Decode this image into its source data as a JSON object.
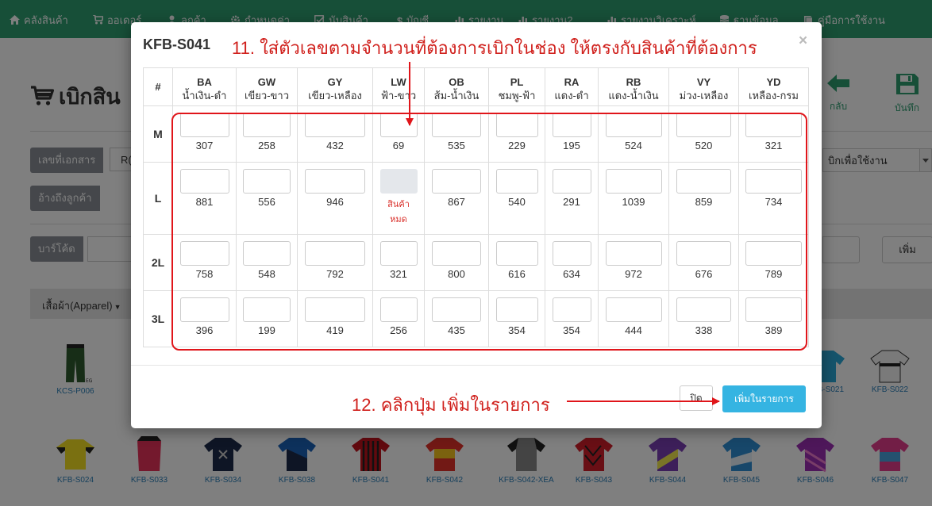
{
  "navbar": {
    "items": [
      {
        "label": "คลังสินค้า",
        "icon": "home-icon"
      },
      {
        "label": "ออเดอร์",
        "icon": "cart-icon"
      },
      {
        "label": "ลูกค้า",
        "icon": "user-icon"
      },
      {
        "label": "กำหนดค่า",
        "icon": "gear-icon"
      },
      {
        "label": "นับสินค้า",
        "icon": "checkbox-icon"
      },
      {
        "label": "บัญชี",
        "icon": "dollar-icon"
      },
      {
        "label": "รายงาน",
        "icon": "bar-chart-icon"
      },
      {
        "label": "รายงาน2",
        "icon": "bar-chart-icon"
      },
      {
        "label": "รายงานวิเคราะห์",
        "icon": "bar-chart-icon"
      },
      {
        "label": "ฐานข้อมูล",
        "icon": "database-icon"
      },
      {
        "label": "คู่มือการใช้งาน",
        "icon": "book-icon"
      }
    ]
  },
  "page": {
    "title": "เบิกสิน",
    "toolbar": {
      "back_label": "กลับ",
      "save_label": "บันทึก"
    },
    "doc_no_label": "เลขที่เอกสาร",
    "doc_no_value": "R(",
    "customer_ref_label": "อ้างถึงลูกค้า",
    "purpose_value": "บิกเพื่อใช้งาน",
    "barcode_label": "บาร์โค้ด",
    "add_label": "เพิ่ม",
    "category_label": "เสื้อผ้า(Apparel)"
  },
  "products": [
    "KCS-P006",
    "KFB-S021",
    "KFB-S022",
    "KFB-S024",
    "KFB-S033",
    "KFB-S034",
    "KFB-S038",
    "KFB-S041",
    "KFB-S042",
    "KFB-S042-XEA",
    "KFB-S043",
    "KFB-S044",
    "KFB-S045",
    "KFB-S046",
    "KFB-S047"
  ],
  "modal": {
    "title": "KFB-S041",
    "close_symbol": "×",
    "hash_header": "#",
    "colors": [
      {
        "code": "BA",
        "name": "น้ำเงิน-ดำ"
      },
      {
        "code": "GW",
        "name": "เขียว-ขาว"
      },
      {
        "code": "GY",
        "name": "เขียว-เหลือง"
      },
      {
        "code": "LW",
        "name": "ฟ้า-ขาว"
      },
      {
        "code": "OB",
        "name": "ส้ม-น้ำเงิน"
      },
      {
        "code": "PL",
        "name": "ชมพู-ฟ้า"
      },
      {
        "code": "RA",
        "name": "แดง-ดำ"
      },
      {
        "code": "RB",
        "name": "แดง-น้ำเงิน"
      },
      {
        "code": "VY",
        "name": "ม่วง-เหลือง"
      },
      {
        "code": "YD",
        "name": "เหลือง-กรม"
      }
    ],
    "rows": [
      {
        "size": "M",
        "stock": [
          "307",
          "258",
          "432",
          "69",
          "535",
          "229",
          "195",
          "524",
          "520",
          "321"
        ]
      },
      {
        "size": "L",
        "stock": [
          "881",
          "556",
          "946",
          null,
          "867",
          "540",
          "291",
          "1039",
          "859",
          "734"
        ]
      },
      {
        "size": "2L",
        "stock": [
          "758",
          "548",
          "792",
          "321",
          "800",
          "616",
          "634",
          "972",
          "676",
          "789"
        ]
      },
      {
        "size": "3L",
        "stock": [
          "396",
          "199",
          "419",
          "256",
          "435",
          "354",
          "354",
          "444",
          "338",
          "389"
        ]
      }
    ],
    "out_of_stock_line1": "สินค้า",
    "out_of_stock_line2": "หมด",
    "close_button": "ปิด",
    "add_button": "เพิ่มในรายการ"
  },
  "annotations": {
    "step11": "11. ใส่ตัวเลขตามจำนวนที่ต้องการเบิกในช่อง ให้ตรงกับสินค้าที่ต้องการ",
    "step12": "12. คลิกปุ่ม เพิ่มในรายการ"
  },
  "colors": {
    "navbar": "#2e9e71",
    "primary": "#35b4e2",
    "annotation": "#e0151a",
    "out_of_stock": "#d9302b"
  }
}
